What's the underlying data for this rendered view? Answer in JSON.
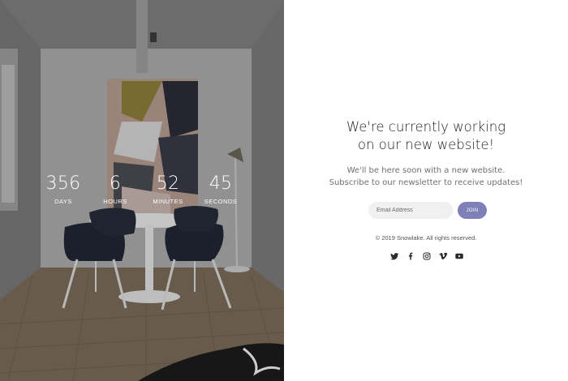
{
  "countdown": {
    "days": {
      "value": "356",
      "label": "DAYS"
    },
    "hours": {
      "value": "6",
      "label": "HOURS"
    },
    "minutes": {
      "value": "52",
      "label": "MINUTES"
    },
    "seconds": {
      "value": "45",
      "label": "SECONDS"
    }
  },
  "content": {
    "headline_line1": "We're currently working",
    "headline_line2": "on our new website!",
    "sub_line1": "We'll be here soon with a new website.",
    "sub_line2": "Subscribe to our newsletter to receive updates!",
    "email_placeholder": "Email Address",
    "join_label": "JOIN",
    "copyright": "© 2019 Snowlake. All rights reserved."
  },
  "social_icons": [
    "twitter-icon",
    "facebook-icon",
    "instagram-icon",
    "vimeo-icon",
    "youtube-icon"
  ],
  "colors": {
    "accent": "#7f80b8",
    "headline": "#1d1d1f",
    "muted_text": "#6f6f6f",
    "input_bg": "#f0f0f0"
  }
}
